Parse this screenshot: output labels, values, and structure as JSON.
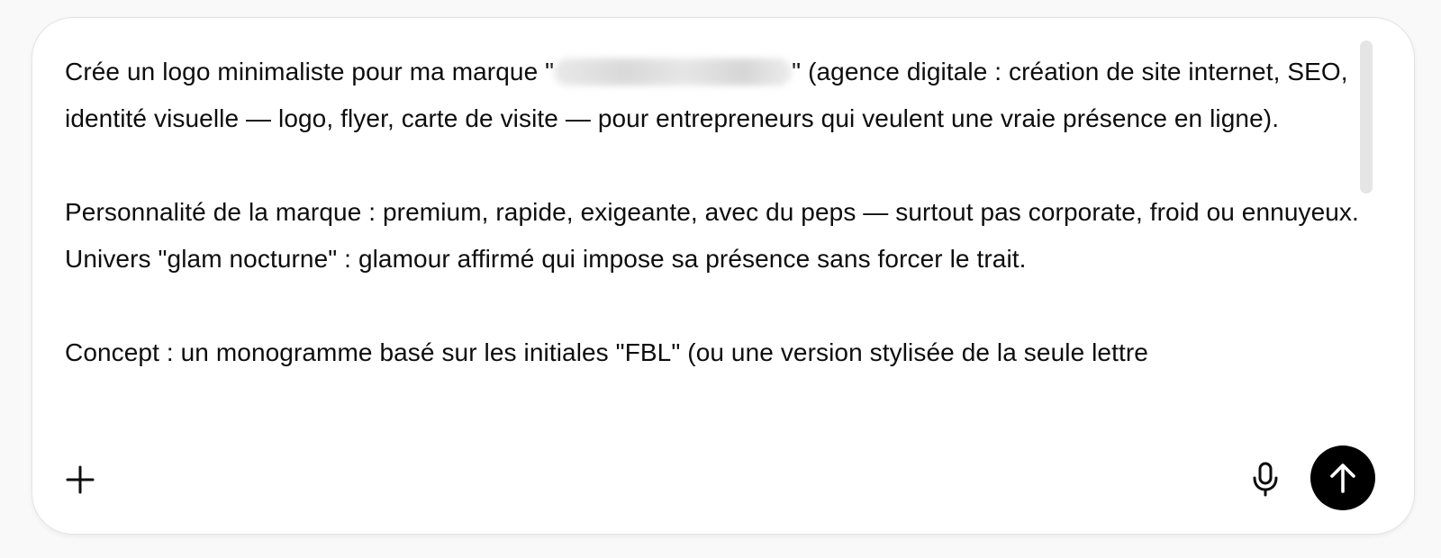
{
  "composer": {
    "paragraphs": [
      {
        "before": "Crée un logo minimaliste pour ma marque \"",
        "after": "\" (agence digitale : création de site internet, SEO, identité visuelle — logo, flyer, carte de visite — pour entrepreneurs qui veulent une vraie présence en ligne)."
      },
      "Personnalité de la marque : premium, rapide, exigeante, avec du peps — surtout pas corporate, froid ou ennuyeux. Univers \"glam nocturne\" : glamour affirmé qui impose sa présence sans forcer le trait.",
      "Concept : un monogramme basé sur les initiales \"FBL\" (ou une version stylisée de la seule lettre"
    ]
  },
  "toolbar": {
    "add_icon": "plus-icon",
    "mic_icon": "microphone-icon",
    "send_icon": "arrow-up-icon"
  },
  "colors": {
    "background": "#f9f9f9",
    "composer_bg": "#ffffff",
    "text": "#0d0d0d",
    "send_button": "#000000"
  }
}
